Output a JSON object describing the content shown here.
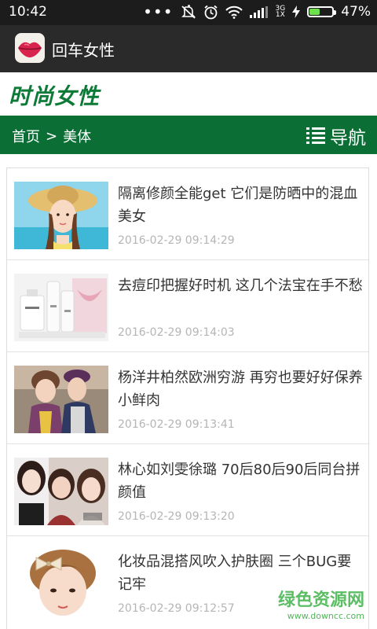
{
  "status_bar": {
    "time": "10:42",
    "network_label_top": "3G",
    "network_label_bottom": "1X",
    "battery_level": 0.47,
    "battery_percent": "47%",
    "icons": [
      "more-icon",
      "mute-icon",
      "alarm-icon",
      "wifi-icon",
      "signal-icon",
      "charging-icon",
      "battery-icon"
    ]
  },
  "app_bar": {
    "title": "回车女性",
    "icon": "lips-app-icon"
  },
  "brand": {
    "title": "时尚女性"
  },
  "nav": {
    "breadcrumb_home": "首页",
    "breadcrumb_sep": ">",
    "breadcrumb_current": "美体",
    "menu_label": "导航",
    "menu_icon": "list-menu-icon"
  },
  "articles": [
    {
      "title": "隔离修颜全能get 它们是防晒中的混血美女",
      "time": "2016-02-29 09:14:29",
      "thumb": "sunhat-girl-beach-image"
    },
    {
      "title": "去痘印把握好时机 这几个法宝在手不愁",
      "time": "2016-02-29 09:14:03",
      "thumb": "skincare-products-image"
    },
    {
      "title": "杨洋井柏然欧洲穷游 再穷也要好好保养小鲜肉",
      "time": "2016-02-29 09:13:41",
      "thumb": "two-young-men-image"
    },
    {
      "title": "林心如刘雯徐璐 70后80后90后同台拼颜值",
      "time": "2016-02-29 09:13:20",
      "thumb": "three-actresses-image"
    },
    {
      "title": "化妆品混搭风吹入护肤圈 三个BUG要记牢",
      "time": "2016-02-29 09:12:57",
      "thumb": "woman-hair-bow-image"
    }
  ],
  "watermark": {
    "name": "绿色资源网",
    "url": "www.downcc.com"
  },
  "colors": {
    "brand_green": "#0b6e35",
    "title_green": "#0d7a37",
    "appbar": "#2a2a2a",
    "statusbar": "#1c1c1c"
  }
}
